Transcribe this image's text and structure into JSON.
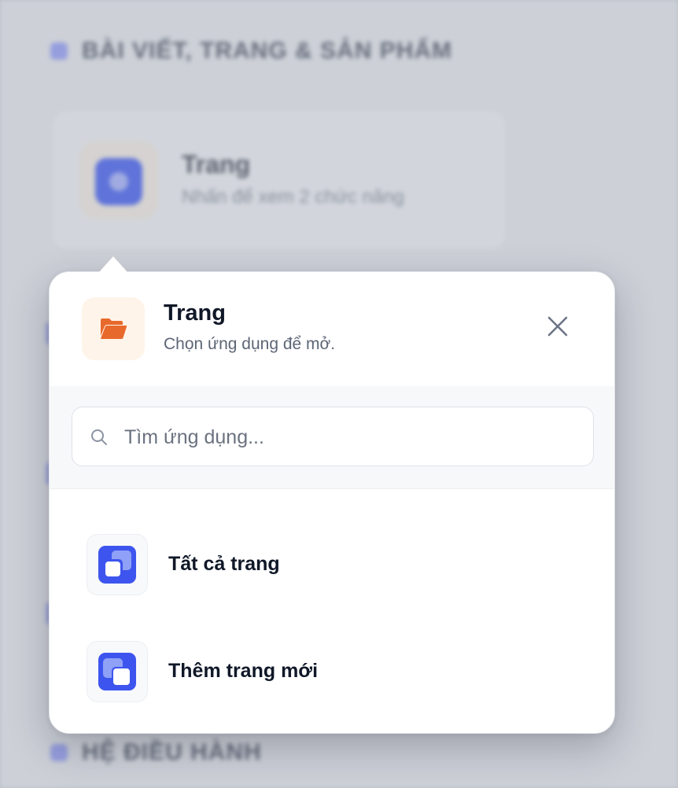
{
  "background": {
    "section_top_label": "BÀI VIẾT, TRANG & SẢN PHẨM",
    "card": {
      "title": "Trang",
      "subtitle": "Nhấn để xem 2 chức năng"
    },
    "section_bottom_label": "HỆ ĐIỀU HÀNH"
  },
  "popover": {
    "header": {
      "icon": "folder-open-icon",
      "title": "Trang",
      "subtitle": "Chọn ứng dụng để mở.",
      "close_icon": "close-icon"
    },
    "search": {
      "icon": "search-icon",
      "placeholder": "Tìm ứng dụng...",
      "value": ""
    },
    "apps": [
      {
        "label": "Tất cả trang",
        "icon": "pages-stack-icon"
      },
      {
        "label": "Thêm trang mới",
        "icon": "add-page-icon"
      }
    ]
  },
  "colors": {
    "accent_blue": "#3d55ee",
    "accent_orange": "#e8692c",
    "header_icon_bg": "#fff4e9",
    "text_primary": "#101828",
    "text_secondary": "#5d6676"
  }
}
